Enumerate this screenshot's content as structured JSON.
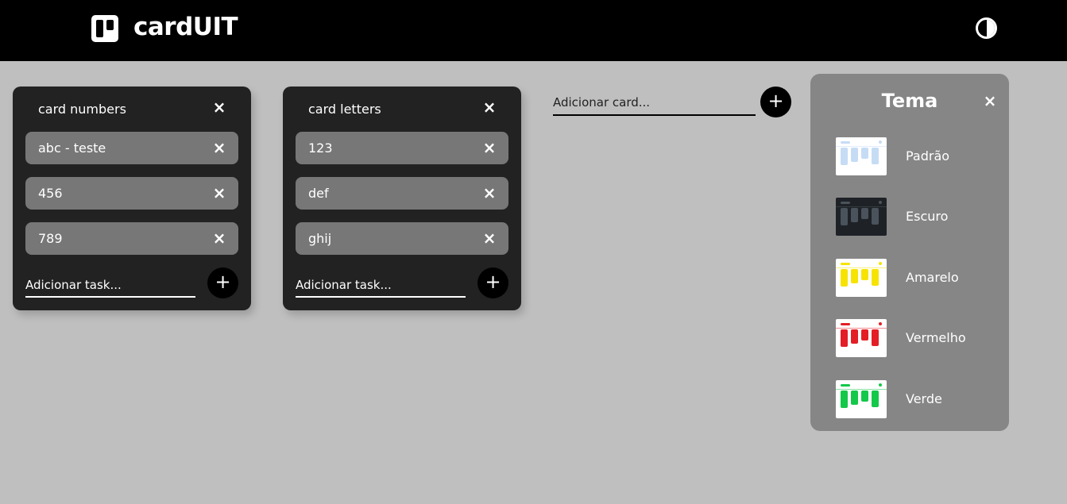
{
  "header": {
    "brand": "cardUIT",
    "logo_icon": "board-icon",
    "theme_toggle_icon": "contrast-icon"
  },
  "cards": [
    {
      "title": "card numbers",
      "tasks": [
        "abc - teste",
        "456",
        "789"
      ],
      "task_placeholder": "Adicionar task..."
    },
    {
      "title": "card letters",
      "tasks": [
        "123",
        "def",
        "ghij"
      ],
      "task_placeholder": "Adicionar task..."
    }
  ],
  "add_card": {
    "placeholder": "Adicionar card..."
  },
  "theme_panel": {
    "title": "Tema",
    "themes": [
      {
        "label": "Padrão",
        "bg": "#ffffff",
        "accent": "#c6dcf5"
      },
      {
        "label": "Escuro",
        "bg": "#1e2227",
        "accent": "#4a525c"
      },
      {
        "label": "Amarelo",
        "bg": "#ffffff",
        "accent": "#f7e300"
      },
      {
        "label": "Vermelho",
        "bg": "#ffffff",
        "accent": "#e41e26"
      },
      {
        "label": "Verde",
        "bg": "#ffffff",
        "accent": "#14c84a"
      }
    ]
  },
  "icons": {
    "close": "×",
    "add": "+"
  }
}
